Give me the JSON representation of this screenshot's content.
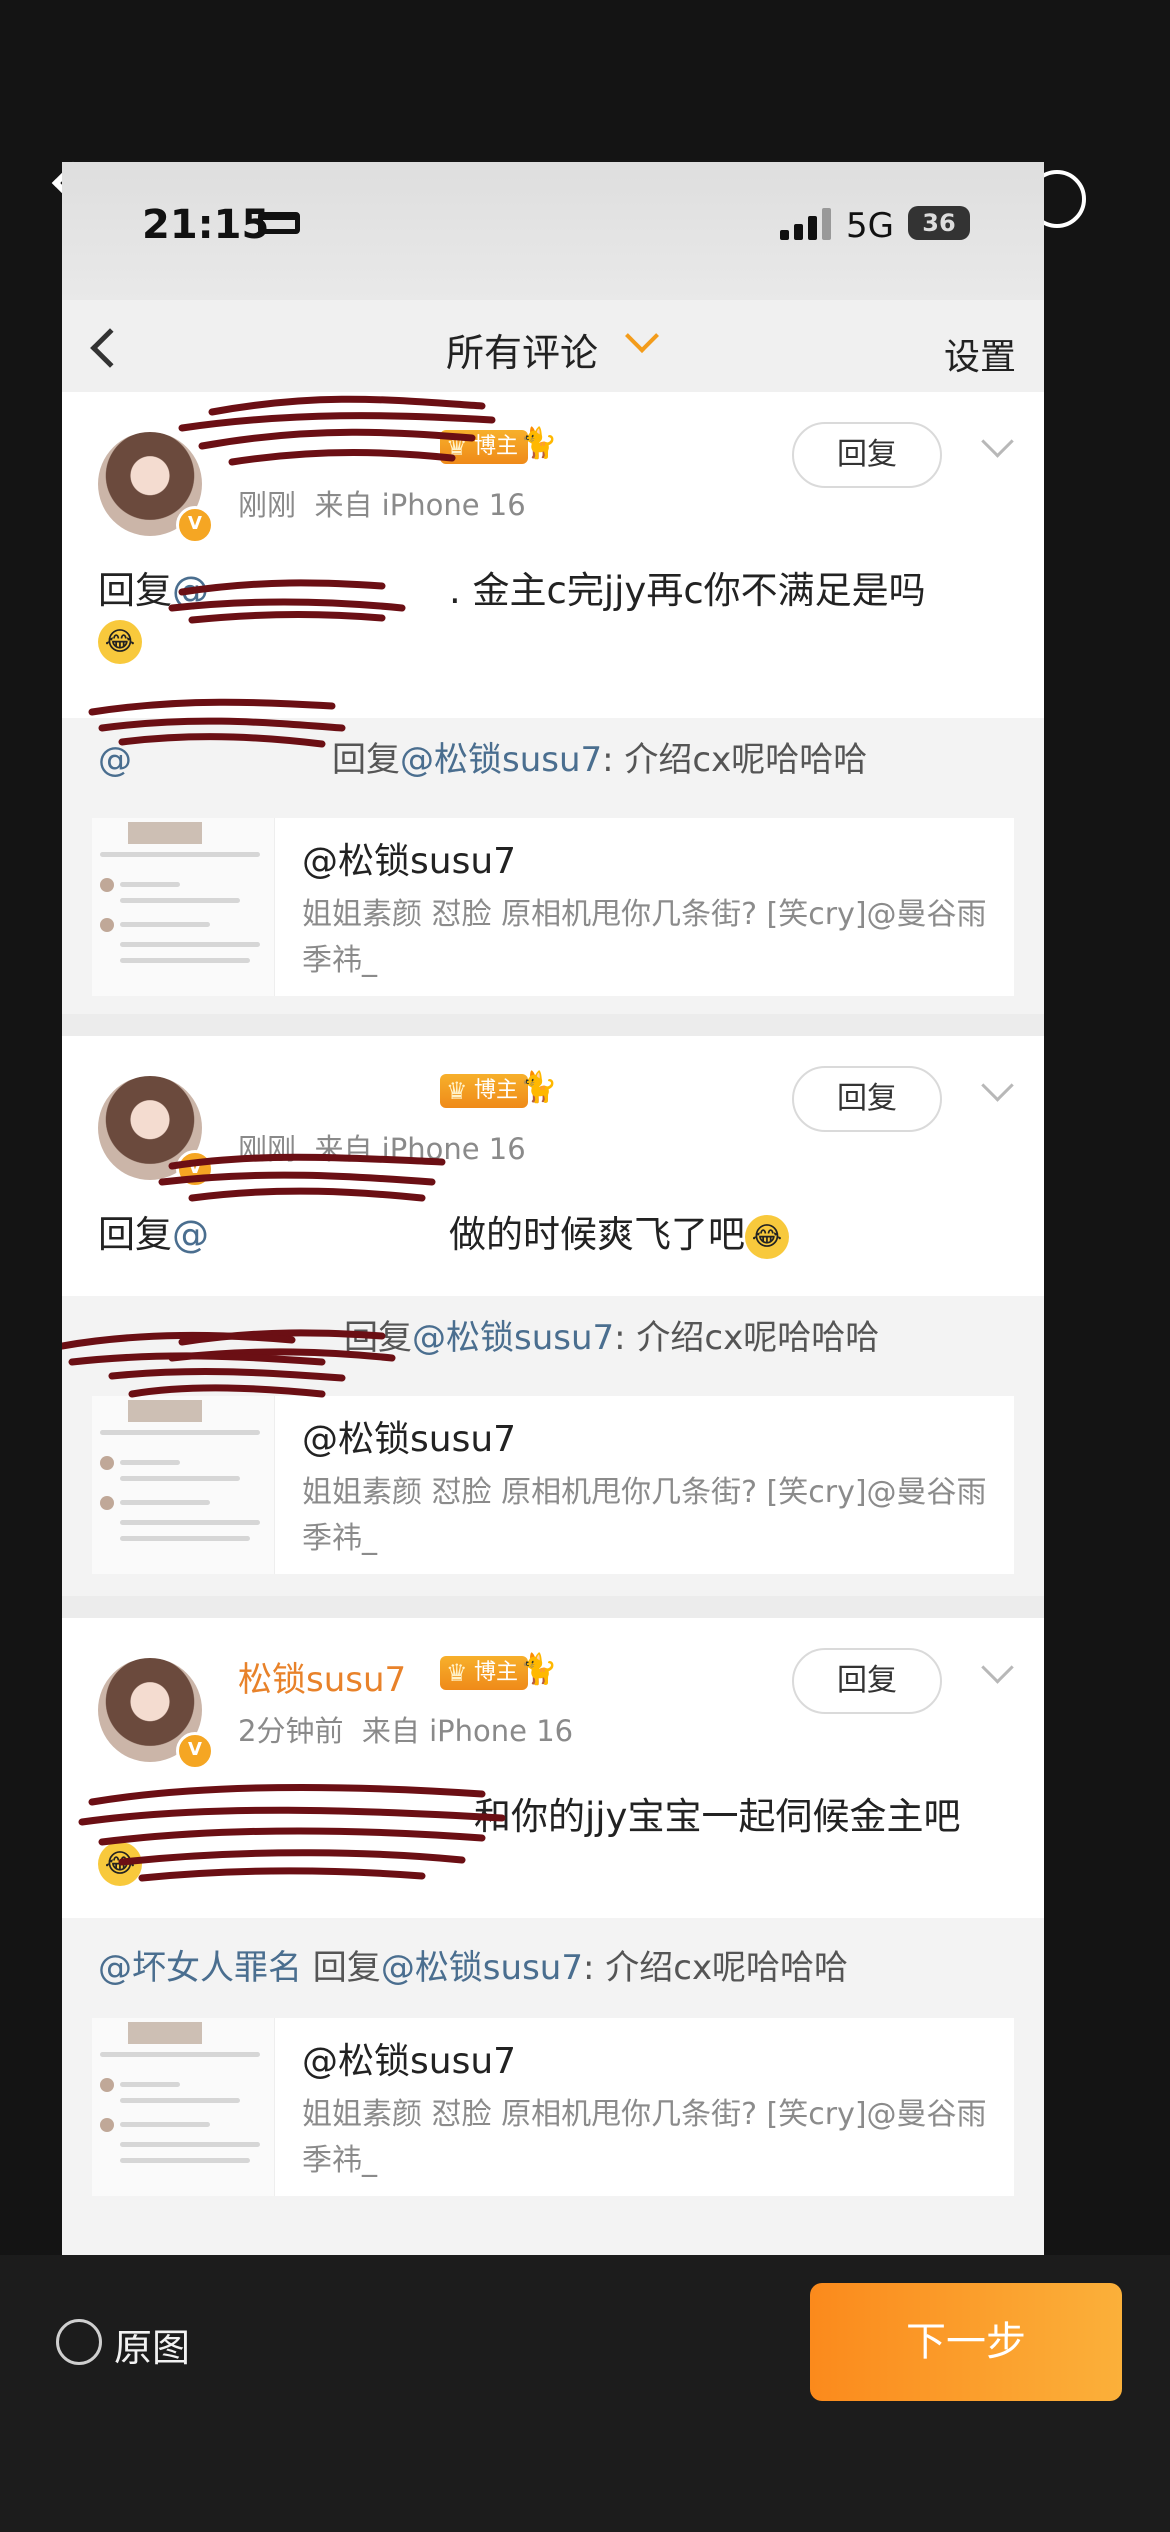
{
  "viewer": {
    "original_label": "原图",
    "next_label": "下一步"
  },
  "status": {
    "time": "21:15",
    "network": "5G",
    "battery": "36"
  },
  "nav": {
    "title": "所有评论",
    "settings": "设置"
  },
  "comments": [
    {
      "username": "",
      "badge": "博主",
      "time": "刚刚",
      "source": "来自 iPhone 16",
      "reply_label": "回复",
      "text_prefix": "回复",
      "text_mention": "@",
      "text_body": ". 金主c完jjy再c你不满足是吗",
      "quote_prefix": "@",
      "quote_body": "回复",
      "quote_mention": "@松锁susu7",
      "quote_text": ": 介绍cx呢哈哈哈",
      "quoted_author": "@松锁susu7",
      "quoted_text": "姐姐素颜 怼脸 原相机甩你几条街? [笑cry]@曼谷雨季祎_"
    },
    {
      "username": "",
      "badge": "博主",
      "time": "刚刚",
      "source": "来自 iPhone 16",
      "reply_label": "回复",
      "text_prefix": "回复",
      "text_mention": "@",
      "text_body": "做的时候爽飞了吧",
      "quote_prefix": "",
      "quote_body": "回复",
      "quote_mention": "@松锁susu7",
      "quote_text": ": 介绍cx呢哈哈哈",
      "quoted_author": "@松锁susu7",
      "quoted_text": "姐姐素颜 怼脸 原相机甩你几条街? [笑cry]@曼谷雨季祎_"
    },
    {
      "username": "松锁susu7",
      "badge": "博主",
      "time": "2分钟前",
      "source": "来自 iPhone 16",
      "reply_label": "回复",
      "text_prefix": "",
      "text_mention": "",
      "text_body": "和你的jjy宝宝一起伺候金主吧",
      "quote_prefix": "@坏女人罪名",
      "quote_body": " 回复",
      "quote_mention": "@松锁susu7",
      "quote_text": ": 介绍cx呢哈哈哈",
      "quoted_author": "@松锁susu7",
      "quoted_text": "姐姐素颜 怼脸 原相机甩你几条街? [笑cry]@曼谷雨季祎_"
    }
  ],
  "colors": {
    "username": "#e8822a",
    "mention": "#4a6e8f",
    "badge": "#f39c1b",
    "scribble": "#6b0f14"
  }
}
